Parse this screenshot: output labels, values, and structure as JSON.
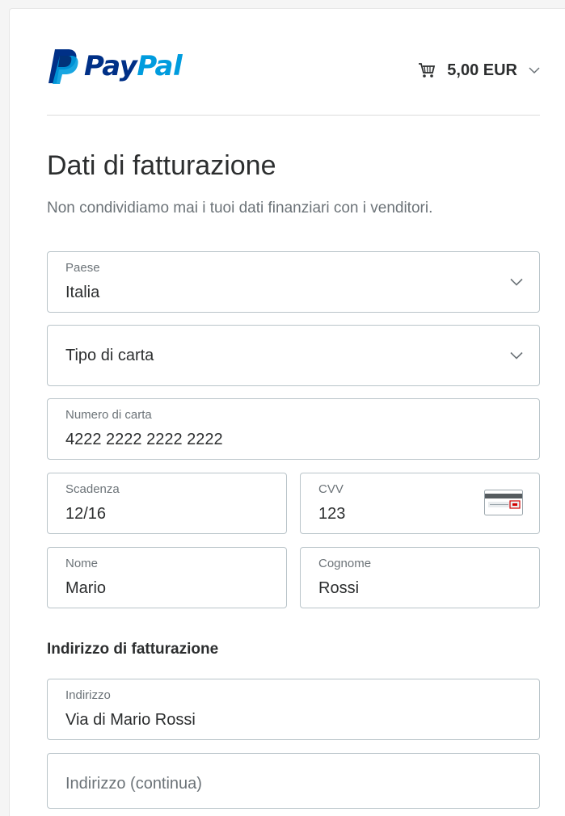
{
  "brand": {
    "logo_pay": "Pay",
    "logo_pal": "Pal",
    "brand_dark": "#003087",
    "brand_light": "#009cde"
  },
  "cart": {
    "amount": "5,00 EUR",
    "icon": "shopping-cart-icon"
  },
  "page": {
    "title": "Dati di fatturazione",
    "subtitle": "Non condividiamo mai i tuoi dati finanziari con i venditori."
  },
  "form": {
    "country": {
      "label": "Paese",
      "value": "Italia"
    },
    "card_type": {
      "placeholder": "Tipo di carta"
    },
    "card_number": {
      "label": "Numero di carta",
      "value": "4222 2222 2222 2222"
    },
    "expiry": {
      "label": "Scadenza",
      "value": "12/16"
    },
    "cvv": {
      "label": "CVV",
      "value": "123",
      "icon": "card-back-cvv-icon"
    },
    "first_name": {
      "label": "Nome",
      "value": "Mario"
    },
    "last_name": {
      "label": "Cognome",
      "value": "Rossi"
    }
  },
  "billing": {
    "section_title": "Indirizzo di fatturazione",
    "address": {
      "label": "Indirizzo",
      "value": "Via di Mario Rossi"
    },
    "address2": {
      "placeholder": "Indirizzo (continua)"
    }
  },
  "colors": {
    "field_border": "#b9c4c9",
    "muted_text": "#6c7378",
    "text": "#2c2e2f"
  }
}
